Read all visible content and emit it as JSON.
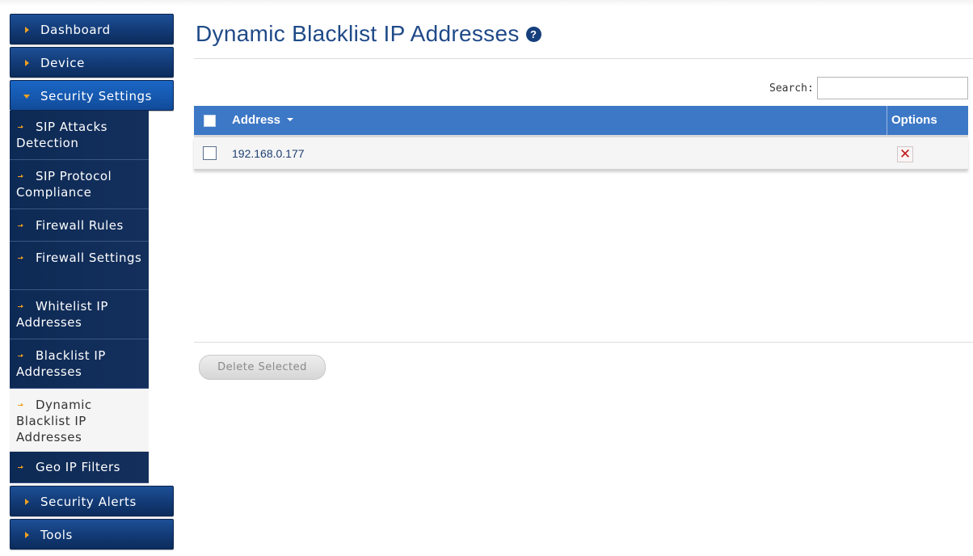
{
  "sidebar": {
    "dashboard": "Dashboard",
    "device": "Device",
    "security_settings": "Security Settings",
    "sub_items": [
      {
        "label": "SIP Attacks Detection"
      },
      {
        "label": "SIP Protocol Compliance"
      },
      {
        "label": "Firewall Rules"
      },
      {
        "label": "Firewall Settings"
      },
      {
        "label": "Whitelist IP Addresses"
      },
      {
        "label": "Blacklist IP Addresses"
      },
      {
        "label": "Dynamic Blacklist IP Addresses"
      },
      {
        "label": "Geo IP Filters"
      }
    ],
    "active_sub_item": "Dynamic Blacklist IP Addresses",
    "security_alerts": "Security Alerts",
    "tools": "Tools"
  },
  "page": {
    "title": "Dynamic Blacklist IP Addresses",
    "help_icon": "help-icon",
    "help_glyph": "?"
  },
  "search": {
    "label": "Search:",
    "value": ""
  },
  "table": {
    "columns": [
      "Address",
      "Options"
    ],
    "sort_column": "Address",
    "rows": [
      {
        "address": "192.168.0.177",
        "selected": false,
        "option_icon": "delete-icon"
      }
    ]
  },
  "actions": {
    "delete_selected": "Delete Selected"
  },
  "colors": {
    "nav_dark": "#0c2c5c",
    "nav_open": "#1557ad",
    "accent_arrow": "#f0a020",
    "title": "#1f4a88",
    "table_header": "#3d78c6",
    "delete_red": "#c0181c"
  }
}
